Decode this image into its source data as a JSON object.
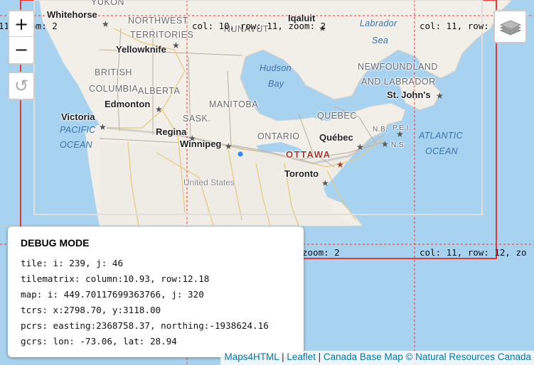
{
  "map": {
    "cities": [
      {
        "name": "Whitehorse"
      },
      {
        "name": "Iqaluit"
      },
      {
        "name": "Yellowknife"
      },
      {
        "name": "Edmonton"
      },
      {
        "name": "Victoria"
      },
      {
        "name": "Regina"
      },
      {
        "name": "Winnipeg"
      },
      {
        "name": "Québec"
      },
      {
        "name": "Toronto"
      },
      {
        "name": "St. John's"
      }
    ],
    "capital": "OTTAWA",
    "regions": {
      "yukon": "YUKON",
      "nwt_1": "NORTHWEST",
      "nwt_2": "TERRITORIES",
      "nunavut": "NUNAVUT",
      "bc_1": "BRITISH",
      "bc_2": "COLUMBIA",
      "alberta": "ALBERTA",
      "sask": "SASK.",
      "manitoba": "MANITOBA",
      "ontario": "ONTARIO",
      "quebec": "QUEBEC",
      "nl_1": "NEWFOUNDLAND",
      "nl_2": "AND LABRADOR",
      "nb": "N.B.",
      "pei": "P.E.I.",
      "ns": "N.S."
    },
    "water": {
      "hudson_1": "Hudson",
      "hudson_2": "Bay",
      "labrador_1": "Labrador",
      "labrador_2": "Sea",
      "pacific_1": "PACIFIC",
      "pacific_2": "OCEAN",
      "atlantic_1": "ATLANTIC",
      "atlantic_2": "OCEAN"
    },
    "country": "United States"
  },
  "tiles": {
    "t1": "11, zoom: 2",
    "t2": "col: 10, row: 11, zoom: 2",
    "t3": "col: 11, row: 11, z",
    "t4": "zoom: 2",
    "t5": "col: 11, row: 12, zo"
  },
  "controls": {
    "zoom_in": "+",
    "zoom_out": "−",
    "reload": "↺"
  },
  "debug": {
    "title": "DEBUG MODE",
    "tile": "tile: i: 239, j: 46",
    "tilematrix": "tilematrix: column:10.93, row:12.18",
    "map": "map: i: 449.70117699363766, j: 320",
    "tcrs": "tcrs: x:2798.70, y:3118.00",
    "pcrs": "pcrs: easting:2368758.37, northing:-1938624.16",
    "gcrs": "gcrs: lon: -73.06, lat: 28.94"
  },
  "attribution": {
    "maps4html": "Maps4HTML",
    "sep1": " | ",
    "leaflet": "Leaflet",
    "sep2": " | ",
    "basemap": "Canada Base Map © Natural Resources Canada"
  }
}
